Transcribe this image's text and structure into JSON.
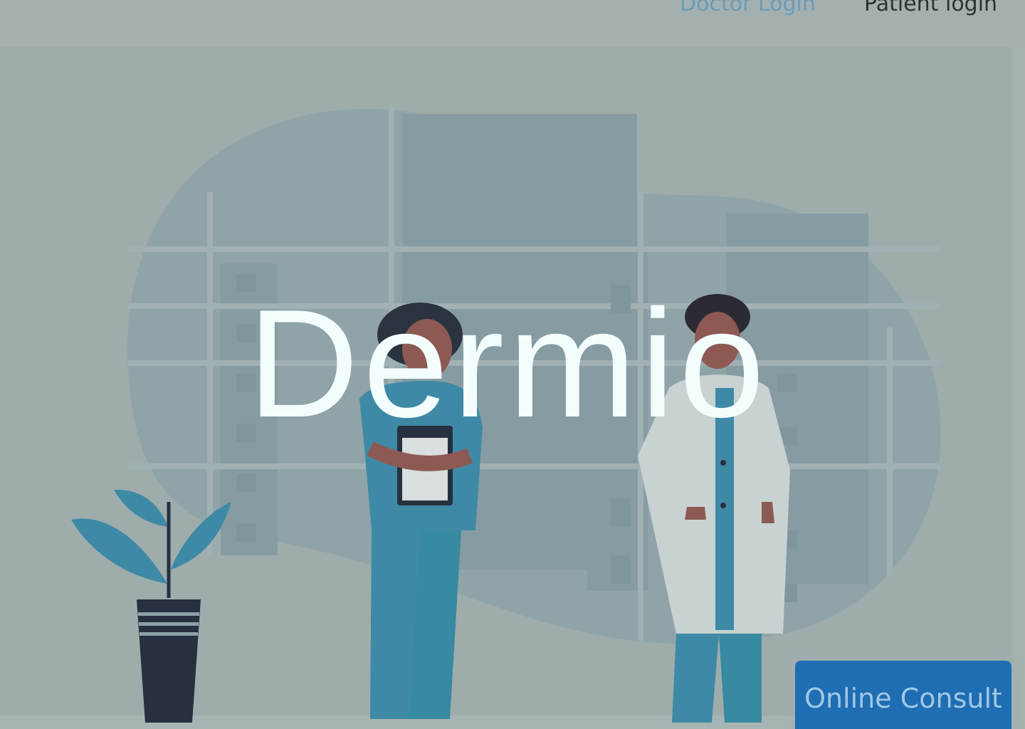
{
  "nav": {
    "doctor_login": "Doctor Login",
    "patient_login": "Patient login"
  },
  "hero": {
    "title": "Dermio",
    "cta_label": "Online Consult"
  },
  "colors": {
    "overlay_bg": "#a6b2b2",
    "title_text": "#f3fdfd",
    "cta_bg": "#1f6db2",
    "nav_doctor": "#6a9cb8",
    "nav_patient": "#2b3333"
  },
  "illustration": {
    "subjects": [
      "nurse-with-clipboard",
      "doctor-in-white-coat",
      "potted-plant",
      "hospital-building-blob"
    ]
  }
}
